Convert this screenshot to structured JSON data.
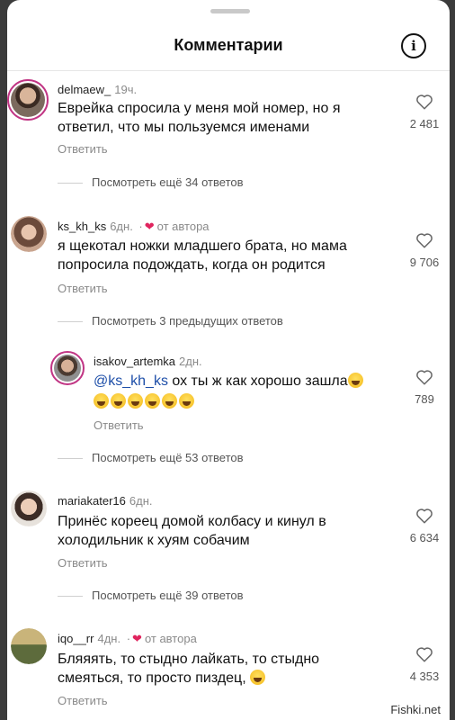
{
  "header": {
    "title": "Комментарии",
    "info_icon": "info-circle-icon"
  },
  "comments": [
    {
      "username": "delmaew_",
      "time": "19ч.",
      "from_author": "",
      "lines": [
        "Еврейка спросила у меня мой номер, но я",
        "ответил, что мы пользуемся именами"
      ],
      "likes": "2 481",
      "reply": "Ответить",
      "more": "Посмотреть ещё 34 ответов"
    },
    {
      "username": "ks_kh_ks",
      "time": "6дн.",
      "from_author": "от автора",
      "lines": [
        "я щекотал ножки младшего брата, но мама",
        "попросила подождать, когда он родится"
      ],
      "likes": "9 706",
      "reply": "Ответить",
      "more": "Посмотреть 3 предыдущих ответов"
    },
    {
      "username": "isakov_artemka",
      "time": "2дн.",
      "from_author": "",
      "mention": "@ks_kh_ks",
      "line1_rest": " ох ты ж как хорошо зашла",
      "likes": "789",
      "reply": "Ответить",
      "more": "Посмотреть ещё 53 ответов"
    },
    {
      "username": "mariakater16",
      "time": "6дн.",
      "from_author": "",
      "lines": [
        "Принёс кореец домой колбасу и кинул в",
        "холодильник к хуям собачим"
      ],
      "likes": "6 634",
      "reply": "Ответить",
      "more": "Посмотреть ещё 39 ответов"
    },
    {
      "username": "iqo__rr",
      "time": "4дн.",
      "from_author": "от автора",
      "lines": [
        "Бляяять, то стыдно лайкать, то стыдно",
        "смеяться, то просто пиздец, "
      ],
      "likes": "4 353",
      "reply": "Ответить"
    }
  ],
  "watermark": "Fishki.net",
  "colors": {
    "heart_red": "#e0245e",
    "mention_blue": "#1d4ea8",
    "story_ring": "#c13584"
  }
}
